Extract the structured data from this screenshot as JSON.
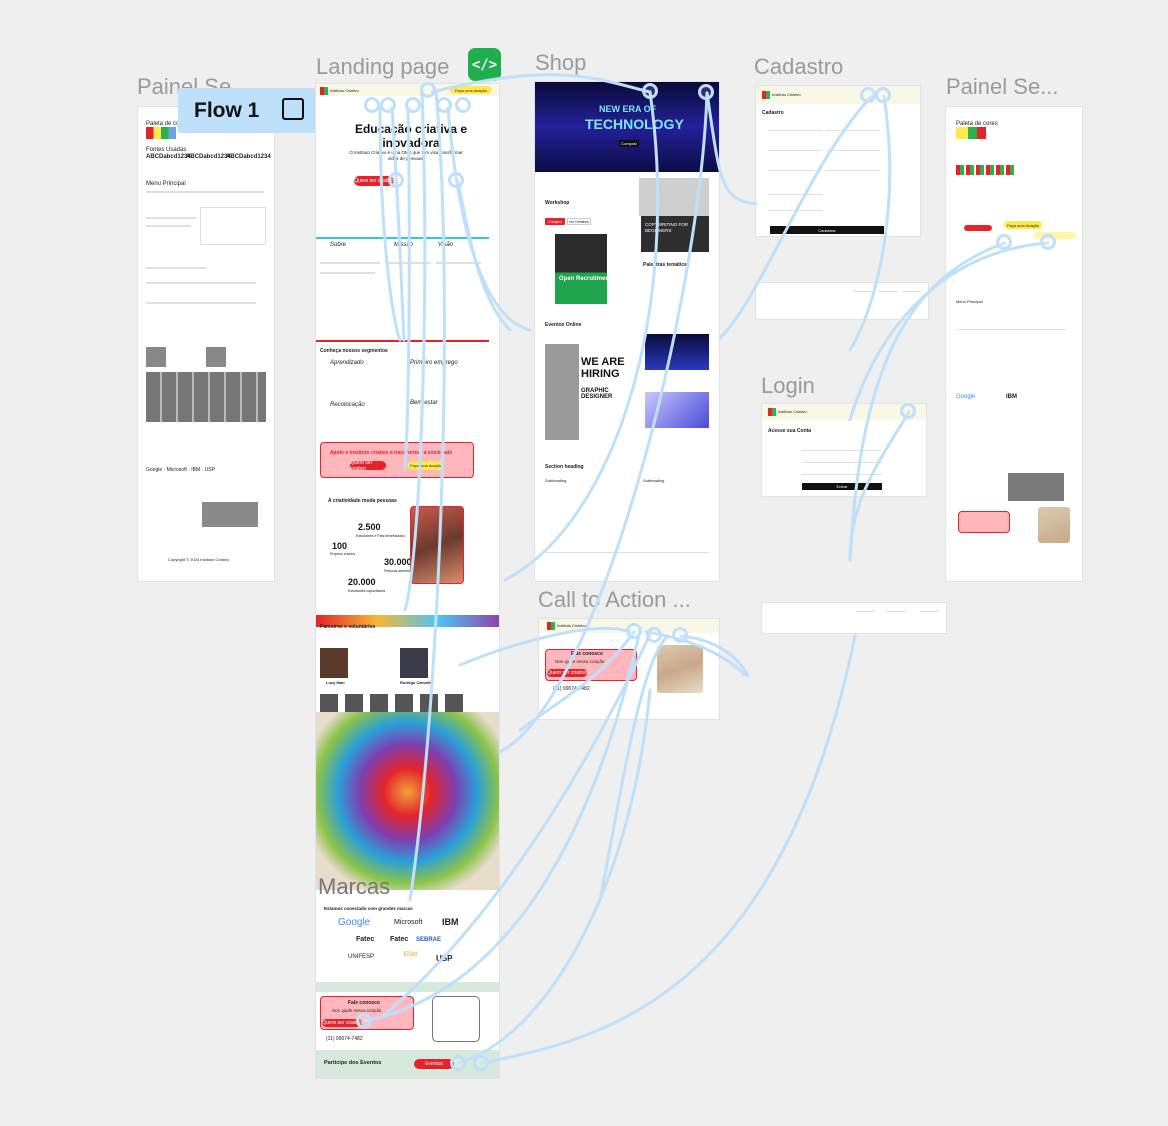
{
  "flow": {
    "label": "Flow 1"
  },
  "frames": {
    "painel_left": "Painel Se...",
    "landing": "Landing page",
    "shop": "Shop",
    "cadastro": "Cadastro",
    "painel_right": "Painel Se...",
    "login": "Login",
    "cta": "Call to Action ...",
    "marcas": "Marcas"
  },
  "landing": {
    "brand": "Instituto Criativo",
    "cta_pill": "Faça uma doação",
    "hero_title": "Educação criativa e inovadora",
    "hero_sub": "O Instituto Criativo é uma ONG que tem visa transformar vidas de pessoas.",
    "hero_button": "Quero ser criativo",
    "sobre": "Sobre",
    "missao": "Missão",
    "visao": "Visão",
    "segments_title": "Conheça nossos segmentos",
    "seg1": "Aprendizado",
    "seg2": "Primeiro emprego",
    "seg3": "Recolocação",
    "seg4": "Bem-estar",
    "help_title": "Ajude o instituto criativo a transformar a sociedade",
    "help_btn1": "Quero ser criativo",
    "help_btn2": "Faça uma doação",
    "stats_title": "A criatividade muda pessoas",
    "stat1": "2.500",
    "stat1_label": "Estudantes e Pais beneficiados",
    "stat2": "100",
    "stat2_label": "Projetos criados",
    "stat3": "30.000",
    "stat3_label": "Pessoas atendidas",
    "stat4": "20.000",
    "stat4_label": "Estudantes capacitados",
    "partners_title": "Parceiros e voluntários",
    "partner1": "Lucy Mari",
    "partner2": "Rodrigo Carvalho",
    "brands_title": "Estamos conectado com grandes marcas",
    "brands": [
      "Google",
      "Microsoft",
      "IBM",
      "Fatec",
      "Fatec",
      "SEBRAE",
      "UNIFESP",
      "ESM",
      "USP"
    ],
    "contact_title": "Fale conosco",
    "contact_sub": "Nos ajude nessa criação",
    "contact_btn": "Quero ser criativo",
    "phone": "(11) 99074-7482",
    "events_title": "Participe dos Eventos",
    "events_btn": "Eventos"
  },
  "shop": {
    "banner1": "NEW ERA OF",
    "banner2": "TECHNOLOGY",
    "banner_btn": "Comprar",
    "workshop": "Workshop",
    "workshop_btn1": "Comprar",
    "workshop_btn2": "Ver Detalhes",
    "open_rec": "Open Recruitment",
    "copywriting": "COPYWRITING FOR BEGINNERS",
    "palestras": "Palestras temáticas",
    "eventos_online": "Eventos Online",
    "hiring1": "WE ARE",
    "hiring2": "HIRING",
    "hiring3": "GRAPHIC DESIGNER",
    "section_heading": "Section heading",
    "sub_heading": "Subheading"
  },
  "cadastro": {
    "brand": "Instituto Criativo",
    "title": "Cadastro",
    "submit": "Cadastrar"
  },
  "login": {
    "brand": "Instituto Criativo",
    "title": "Acesse sua Conta",
    "submit": "Entrar"
  },
  "cta": {
    "brand": "Instituto Criativo",
    "title": "Fale conosco",
    "sub": "Nos ajude nessa criação",
    "btn": "Quero ser criativo",
    "phone": "(11) 99074-7482"
  },
  "painel": {
    "palette": "Paleta de cores",
    "fonts": "Fontes Usadas",
    "sample": "ABCDabcd1234",
    "menu": "Menu Principal",
    "footer": "Copyright © 2024 Instituto Criativo",
    "footer2": "Created and Development with",
    "footer_by": "by Lion Design"
  },
  "colors": {
    "accent": "#e3242b",
    "flow_line": "#bfe0fa",
    "badge": "#1fb04d",
    "yellow": "#ffe94d"
  }
}
